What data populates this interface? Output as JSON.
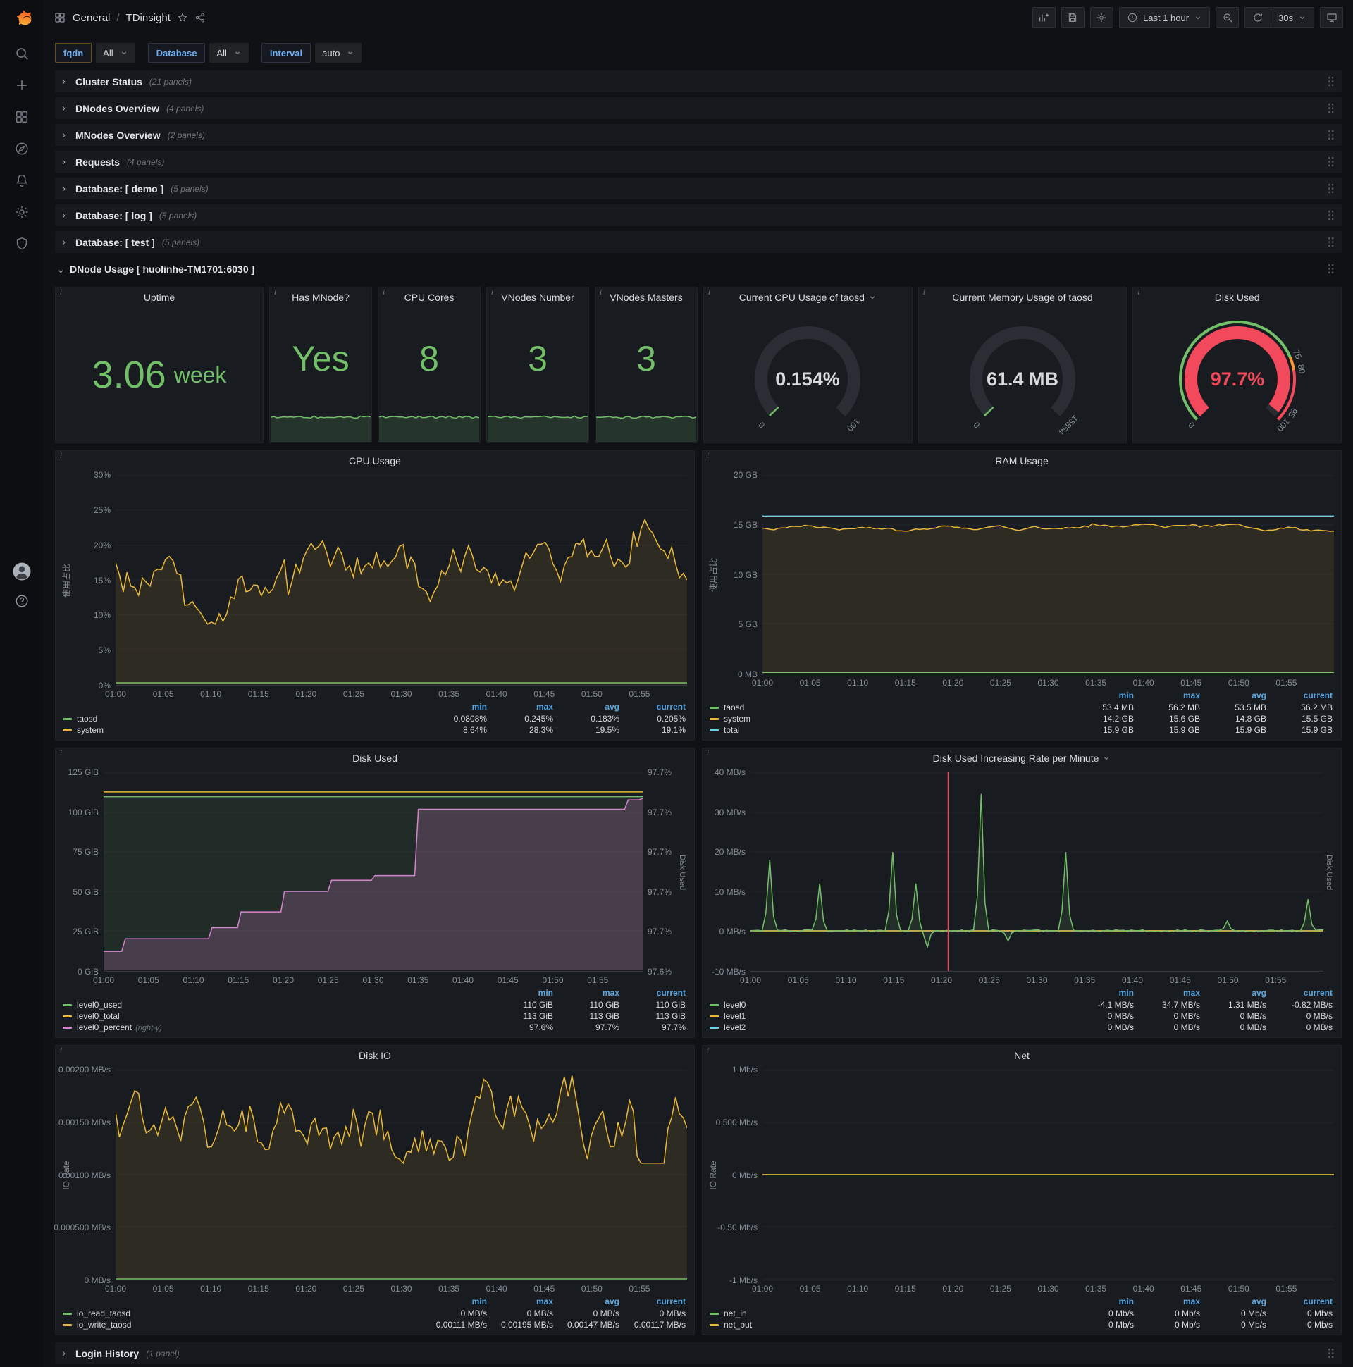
{
  "topnav": {
    "section": "General",
    "separator": "/",
    "page": "TDinsight",
    "time_range": "Last 1 hour",
    "refresh_interval": "30s"
  },
  "sidebar": {
    "items": [
      "search",
      "create",
      "dashboards",
      "explore",
      "alerting",
      "configuration",
      "server-admin"
    ],
    "bottom": [
      "profile",
      "help"
    ]
  },
  "filters": [
    {
      "label": "fqdn",
      "value": "All",
      "accent": "orange"
    },
    {
      "label": "Database",
      "value": "All",
      "accent": "blue"
    },
    {
      "label": "Interval",
      "value": "auto",
      "accent": "blue"
    }
  ],
  "rows_top": [
    {
      "title": "Cluster Status",
      "count": "(21 panels)"
    },
    {
      "title": "DNodes Overview",
      "count": "(4 panels)"
    },
    {
      "title": "MNodes Overview",
      "count": "(2 panels)"
    },
    {
      "title": "Requests",
      "count": "(4 panels)"
    },
    {
      "title": "Database: [ demo ]",
      "count": "(5 panels)"
    },
    {
      "title": "Database: [ log ]",
      "count": "(5 panels)"
    },
    {
      "title": "Database: [ test ]",
      "count": "(5 panels)"
    }
  ],
  "expanded_row": {
    "title": "DNode Usage [ huolinhe-TM1701:6030 ]"
  },
  "bottom_row": {
    "title": "Login History",
    "count": "(1 panel)"
  },
  "colors": {
    "green": "#73bf69",
    "yellow": "#eab839",
    "cyan": "#6ed0e0",
    "pink": "#d683ce",
    "red": "#f2495c",
    "legend_header_blue": "#58a6e0"
  },
  "time_ticks": [
    "01:00",
    "01:05",
    "01:10",
    "01:15",
    "01:20",
    "01:25",
    "01:30",
    "01:35",
    "01:40",
    "01:45",
    "01:50",
    "01:55"
  ],
  "stats": [
    {
      "type": "big",
      "title": "Uptime",
      "value": "3.06",
      "unit": "week"
    },
    {
      "type": "spark",
      "title": "Has MNode?",
      "value": "Yes"
    },
    {
      "type": "spark",
      "title": "CPU Cores",
      "value": "8"
    },
    {
      "type": "spark",
      "title": "VNodes Number",
      "value": "3"
    },
    {
      "type": "spark",
      "title": "VNodes Masters",
      "value": "3"
    },
    {
      "type": "gauge",
      "title": "Current CPU Usage of taosd",
      "caret": true,
      "value": "0.154%",
      "fraction": 0.00154,
      "min_label": "0",
      "max_label": "100",
      "value_color": "#d8d9da",
      "arc_color": "#73bf69"
    },
    {
      "type": "gauge",
      "title": "Current Memory Usage of taosd",
      "value": "61.4 MB",
      "fraction": 0.0039,
      "min_label": "0",
      "max_label": "15854",
      "value_color": "#d8d9da",
      "arc_color": "#73bf69"
    },
    {
      "type": "gauge",
      "title": "Disk Used",
      "value": "97.7%",
      "fraction": 0.977,
      "min_label": "0",
      "value_color": "#f2495c",
      "arc_color": "#f2495c",
      "ring": [
        {
          "from": 0,
          "to": 0.75,
          "color": "#73bf69"
        },
        {
          "from": 0.75,
          "to": 0.8,
          "color": "#ff9830"
        },
        {
          "from": 0.8,
          "to": 1,
          "color": "#f2495c"
        }
      ],
      "ring_labels": [
        {
          "frac": 0.75,
          "text": "75"
        },
        {
          "frac": 0.8,
          "text": "80"
        },
        {
          "frac": 0.95,
          "text": "95"
        },
        {
          "frac": 1,
          "text": "100"
        }
      ]
    }
  ],
  "charts": [
    {
      "title": "CPU Usage",
      "y_label": "使用占比",
      "y_range": [
        0,
        30
      ],
      "y_ticks": [
        "30%",
        "25%",
        "20%",
        "15%",
        "10%",
        "5%",
        "0%"
      ],
      "legend_cols": [
        "min",
        "max",
        "avg",
        "current"
      ],
      "legend_rows": [
        {
          "name": "taosd",
          "color": "#73bf69",
          "values": [
            "0.0808%",
            "0.245%",
            "0.183%",
            "0.205%"
          ]
        },
        {
          "name": "system",
          "color": "#eab839",
          "values": [
            "8.64%",
            "28.3%",
            "19.5%",
            "19.1%"
          ]
        }
      ],
      "series": [
        {
          "color": "#73bf69",
          "fill": 0.08,
          "gen": {
            "type": "flat",
            "v": 0.2
          }
        },
        {
          "color": "#eab839",
          "fill": 0.1,
          "gen": {
            "type": "walk",
            "base": 19.0,
            "amp": 9,
            "min": 8.64,
            "max": 28.3,
            "seed": 7
          }
        }
      ]
    },
    {
      "title": "RAM Usage",
      "y_label": "使用占比",
      "y_range": [
        0,
        20
      ],
      "y_ticks": [
        "20 GB",
        "15 GB",
        "10 GB",
        "5 GB",
        "0 MB"
      ],
      "legend_cols": [
        "min",
        "max",
        "avg",
        "current"
      ],
      "legend_rows": [
        {
          "name": "taosd",
          "color": "#73bf69",
          "values": [
            "53.4 MB",
            "56.2 MB",
            "53.5 MB",
            "56.2 MB"
          ]
        },
        {
          "name": "system",
          "color": "#eab839",
          "values": [
            "14.2 GB",
            "15.6 GB",
            "14.8 GB",
            "15.5 GB"
          ]
        },
        {
          "name": "total",
          "color": "#6ed0e0",
          "values": [
            "15.9 GB",
            "15.9 GB",
            "15.9 GB",
            "15.9 GB"
          ]
        }
      ],
      "series": [
        {
          "color": "#73bf69",
          "fill": 0.06,
          "gen": {
            "type": "flat",
            "v": 0.055
          }
        },
        {
          "color": "#eab839",
          "fill": 0.1,
          "gen": {
            "type": "walk",
            "base": 14.75,
            "amp": 0.5,
            "min": 14.2,
            "max": 15.2,
            "seed": 5
          }
        },
        {
          "color": "#6ed0e0",
          "fill": 0,
          "gen": {
            "type": "flat",
            "v": 15.9
          }
        }
      ]
    },
    {
      "title": "Disk Used",
      "y_range": [
        0,
        125
      ],
      "y_ticks": [
        "125 GiB",
        "100 GiB",
        "75 GiB",
        "50 GiB",
        "25 GiB",
        "0 GiB"
      ],
      "right_range": [
        97.595,
        97.72
      ],
      "right_ticks": [
        "97.7%",
        "97.7%",
        "97.7%",
        "97.7%",
        "97.7%",
        "97.6%"
      ],
      "right_label": "Disk Used",
      "legend_cols": [
        "min",
        "max",
        "current"
      ],
      "legend_rows": [
        {
          "name": "level0_used",
          "color": "#73bf69",
          "values": [
            "110 GiB",
            "110 GiB",
            "110 GiB"
          ]
        },
        {
          "name": "level0_total",
          "color": "#eab839",
          "values": [
            "113 GiB",
            "113 GiB",
            "113 GiB"
          ]
        },
        {
          "name": "level0_percent",
          "note": "(right-y)",
          "color": "#d683ce",
          "values": [
            "97.6%",
            "97.7%",
            "97.7%"
          ]
        }
      ],
      "series": [
        {
          "color": "#73bf69",
          "fill": 0.1,
          "gen": {
            "type": "flat",
            "v": 110
          }
        },
        {
          "color": "#eab839",
          "fill": 0,
          "gen": {
            "type": "flat",
            "v": 113
          }
        },
        {
          "color": "#d683ce",
          "fill": 0.22,
          "axis": "right",
          "gen": {
            "type": "steps",
            "pts": [
              [
                0,
                97.607
              ],
              [
                0.04,
                97.615
              ],
              [
                0.2,
                97.622
              ],
              [
                0.25,
                97.632
              ],
              [
                0.33,
                97.645
              ],
              [
                0.42,
                97.652
              ],
              [
                0.5,
                97.655
              ],
              [
                0.58,
                97.697
              ],
              [
                0.97,
                97.703
              ],
              [
                1,
                97.704
              ]
            ]
          }
        }
      ]
    },
    {
      "title": "Disk Used Increasing Rate per Minute",
      "caret": true,
      "y_range": [
        -10,
        40
      ],
      "y_ticks": [
        "40 MB/s",
        "30 MB/s",
        "20 MB/s",
        "10 MB/s",
        "0 MB/s",
        "-10 MB/s"
      ],
      "right_label": "Disk Used",
      "annotation_x": 0.345,
      "legend_cols": [
        "min",
        "max",
        "avg",
        "current"
      ],
      "legend_rows": [
        {
          "name": "level0",
          "color": "#73bf69",
          "values": [
            "-4.1 MB/s",
            "34.7 MB/s",
            "1.31 MB/s",
            "-0.82 MB/s"
          ]
        },
        {
          "name": "level1",
          "color": "#eab839",
          "values": [
            "0 MB/s",
            "0 MB/s",
            "0 MB/s",
            "0 MB/s"
          ]
        },
        {
          "name": "level2",
          "color": "#6ed0e0",
          "values": [
            "0 MB/s",
            "0 MB/s",
            "0 MB/s",
            "0 MB/s"
          ]
        }
      ],
      "series": [
        {
          "color": "#6ed0e0",
          "fill": 0,
          "gen": {
            "type": "flat",
            "v": 0
          }
        },
        {
          "color": "#eab839",
          "fill": 0,
          "gen": {
            "type": "flat",
            "v": 0
          }
        },
        {
          "color": "#73bf69",
          "fill": 0.12,
          "gen": {
            "type": "spikes",
            "noise": 0.25,
            "seed": 13,
            "spikes": [
              [
                0.035,
                18
              ],
              [
                0.12,
                12
              ],
              [
                0.25,
                20
              ],
              [
                0.29,
                12
              ],
              [
                0.31,
                -4.1
              ],
              [
                0.4,
                34.7
              ],
              [
                0.45,
                -2.5
              ],
              [
                0.55,
                20
              ],
              [
                0.83,
                2.5
              ],
              [
                0.97,
                8
              ]
            ]
          }
        }
      ]
    },
    {
      "title": "Disk IO",
      "y_label": "IO Rate",
      "y_range": [
        0,
        0.002
      ],
      "y_ticks": [
        "0.00200 MB/s",
        "0.00150 MB/s",
        "0.00100 MB/s",
        "0.000500 MB/s",
        "0 MB/s"
      ],
      "legend_cols": [
        "min",
        "max",
        "avg",
        "current"
      ],
      "legend_rows": [
        {
          "name": "io_read_taosd",
          "color": "#73bf69",
          "values": [
            "0 MB/s",
            "0 MB/s",
            "0 MB/s",
            "0 MB/s"
          ]
        },
        {
          "name": "io_write_taosd",
          "color": "#eab839",
          "values": [
            "0.00111 MB/s",
            "0.00195 MB/s",
            "0.00147 MB/s",
            "0.00117 MB/s"
          ]
        }
      ],
      "series": [
        {
          "color": "#73bf69",
          "fill": 0.06,
          "gen": {
            "type": "flat",
            "v": 0
          }
        },
        {
          "color": "#eab839",
          "fill": 0.1,
          "gen": {
            "type": "walk",
            "base": 0.0015,
            "amp": 0.0009,
            "min": 0.00111,
            "max": 0.00195,
            "seed": 9
          }
        }
      ]
    },
    {
      "title": "Net",
      "y_label": "IO Rate",
      "y_range": [
        -1,
        1
      ],
      "y_ticks": [
        "1 Mb/s",
        "0.500 Mb/s",
        "0 Mb/s",
        "-0.50 Mb/s",
        "-1 Mb/s"
      ],
      "legend_cols": [
        "min",
        "max",
        "avg",
        "current"
      ],
      "legend_rows": [
        {
          "name": "net_in",
          "color": "#73bf69",
          "values": [
            "0 Mb/s",
            "0 Mb/s",
            "0 Mb/s",
            "0 Mb/s"
          ]
        },
        {
          "name": "net_out",
          "color": "#eab839",
          "values": [
            "0 Mb/s",
            "0 Mb/s",
            "0 Mb/s",
            "0 Mb/s"
          ]
        }
      ],
      "series": [
        {
          "color": "#73bf69",
          "fill": 0,
          "gen": {
            "type": "flat",
            "v": 0
          }
        },
        {
          "color": "#eab839",
          "fill": 0,
          "gen": {
            "type": "flat",
            "v": 0
          }
        }
      ]
    }
  ]
}
